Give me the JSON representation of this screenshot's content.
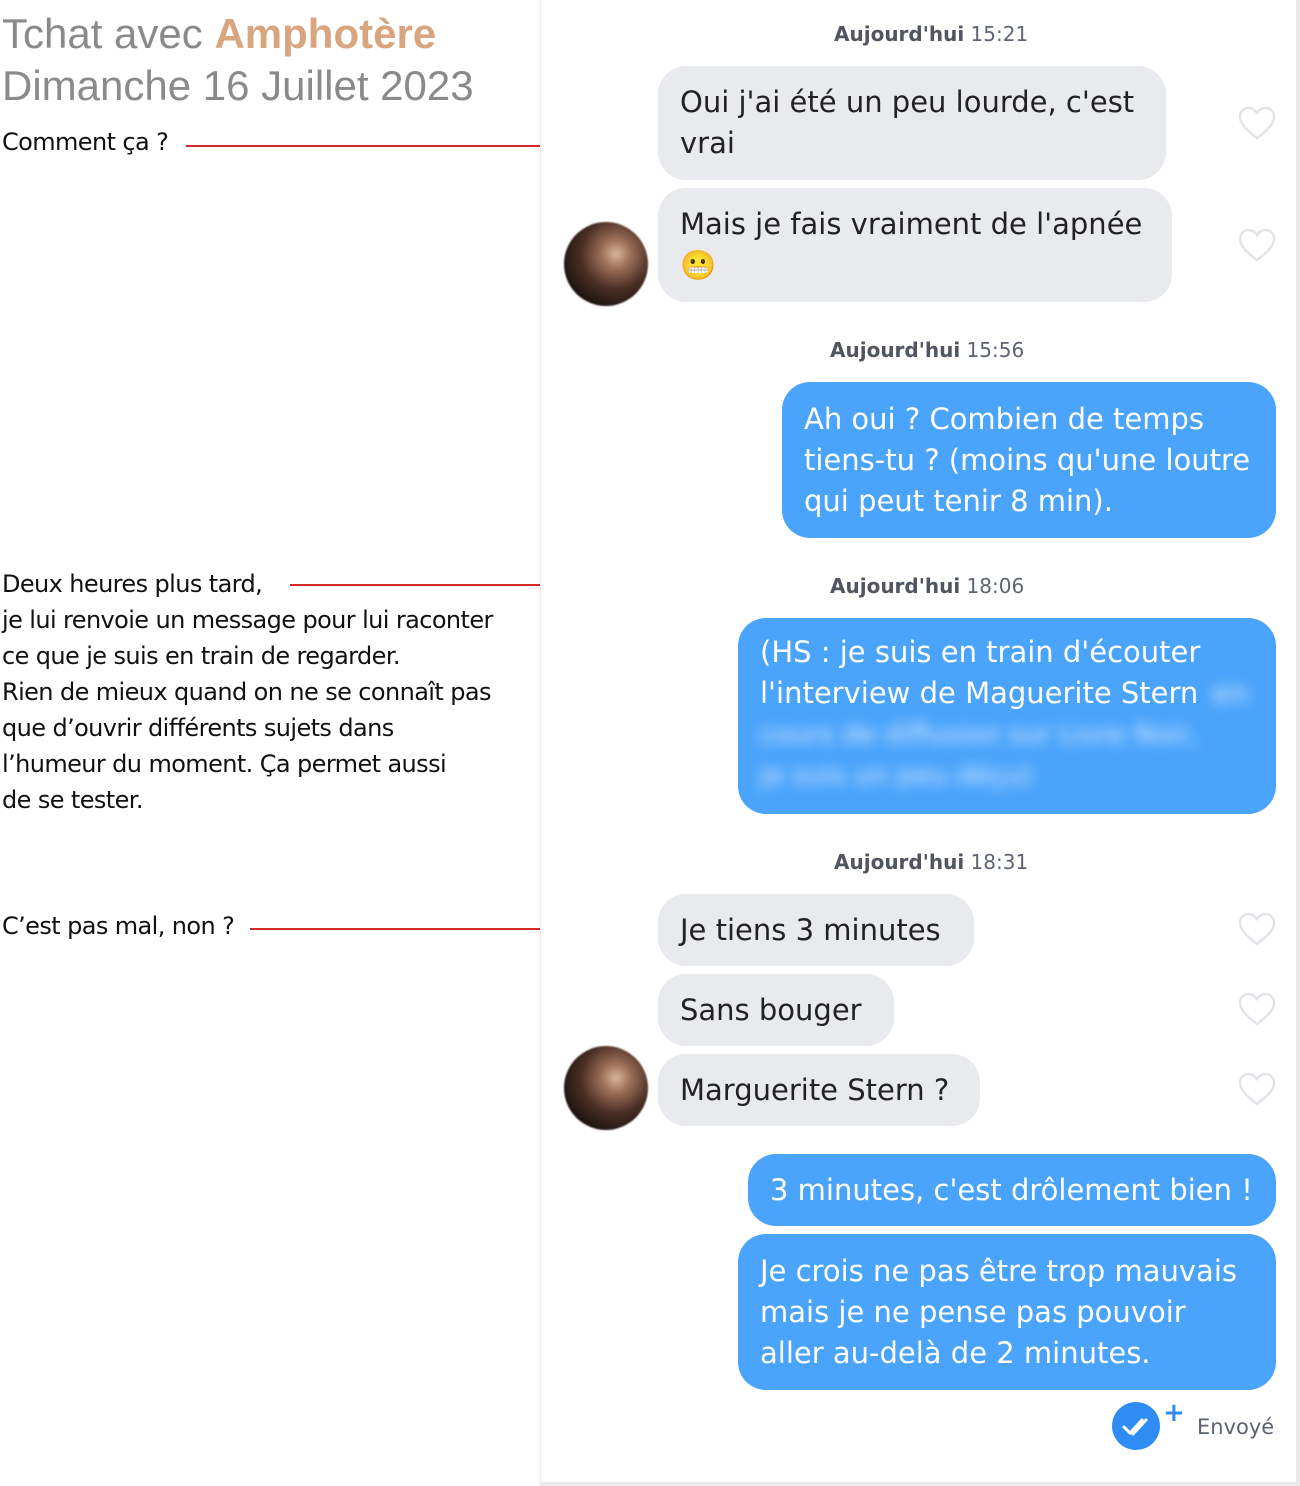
{
  "header": {
    "title_prefix": "Tchat avec ",
    "title_name": "Amphotère",
    "date": "Dimanche 16 Juillet 2023"
  },
  "annotations": {
    "note1": "Comment ça ?",
    "note2": [
      "Deux heures plus tard,",
      "je lui renvoie un message pour lui raconter",
      "ce que je suis en train de regarder.",
      "Rien de mieux quand on ne se connaît pas",
      "que d’ouvrir différents sujets dans",
      "l’humeur du moment. Ça permet aussi",
      "de se tester."
    ],
    "note3": "C’est pas mal, non ?"
  },
  "chat": {
    "stamps": [
      {
        "day": "Aujourd'hui",
        "time": "15:21"
      },
      {
        "day": "Aujourd'hui",
        "time": "15:56"
      },
      {
        "day": "Aujourd'hui",
        "time": "18:06"
      },
      {
        "day": "Aujourd'hui",
        "time": "18:31"
      }
    ],
    "messages": [
      {
        "side": "in",
        "text": "Oui j'ai été un peu lourde, c'est\nvrai"
      },
      {
        "side": "in",
        "text": "Mais je fais vraiment de l'apnée\n😬"
      },
      {
        "side": "out",
        "text": "Ah oui ? Combien de temps\ntiens-tu ? (moins qu'une loutre\nqui peut tenir 8 min)."
      },
      {
        "side": "out",
        "text": "(HS : je suis en train d'écouter\nl'interview de Maguerite Stern",
        "blurred_text": "en\ncours de diffusion sur Livre Noir,\nje suis un peu déçu)"
      },
      {
        "side": "in",
        "text": "Je tiens 3 minutes"
      },
      {
        "side": "in",
        "text": "Sans bouger"
      },
      {
        "side": "in",
        "text": "Marguerite Stern ?"
      },
      {
        "side": "out",
        "text": "3 minutes, c'est drôlement bien !"
      },
      {
        "side": "out",
        "text": "Je crois ne pas être trop mauvais\nmais je ne pense pas pouvoir\naller au-delà de 2 minutes."
      }
    ],
    "status": {
      "plus": "+",
      "label": "Envoyé"
    }
  },
  "colors": {
    "incoming_bubble": "#e9eaee",
    "outgoing_bubble": "#4ba4fb",
    "leader_line": "#d52b2b",
    "title_name": "#d9a57f"
  },
  "icons": [
    "heart-icon",
    "check-double-icon",
    "avatar"
  ]
}
